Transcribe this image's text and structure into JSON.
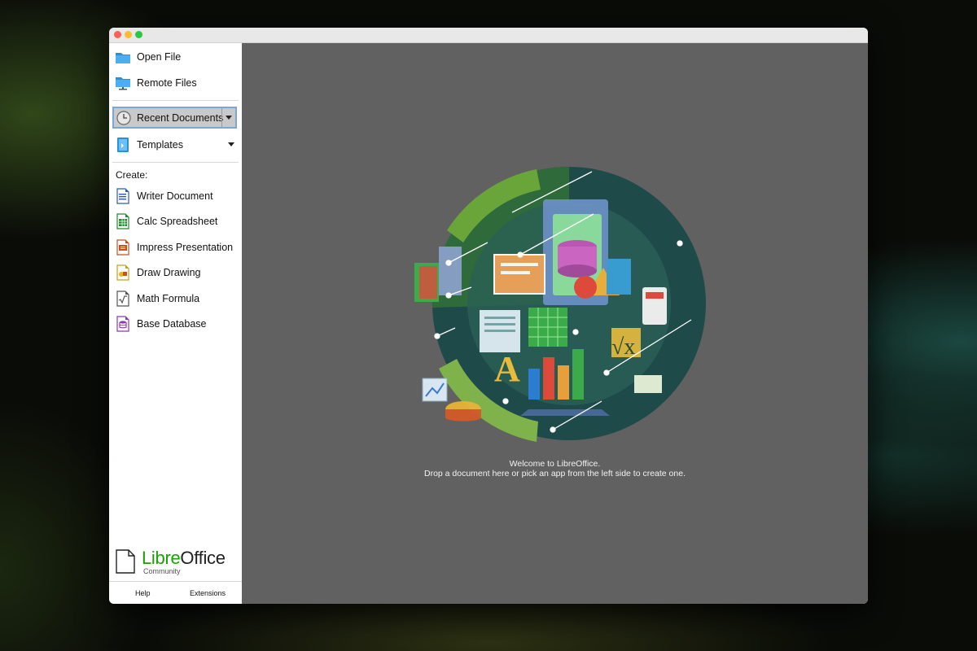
{
  "window": {
    "title": ""
  },
  "sidebar": {
    "open_file": "Open File",
    "remote_files": "Remote Files",
    "recent_documents": "Recent Documents",
    "templates": "Templates",
    "create_label": "Create:",
    "create_items": [
      {
        "label": "Writer Document",
        "icon": "writer-icon",
        "color": "#2a5bb5"
      },
      {
        "label": "Calc Spreadsheet",
        "icon": "calc-icon",
        "color": "#1f8a28"
      },
      {
        "label": "Impress Presentation",
        "icon": "impress-icon",
        "color": "#c8501a"
      },
      {
        "label": "Draw Drawing",
        "icon": "draw-icon",
        "color": "#c8a01a"
      },
      {
        "label": "Math Formula",
        "icon": "math-icon",
        "color": "#555555"
      },
      {
        "label": "Base Database",
        "icon": "base-icon",
        "color": "#8e3aa8"
      }
    ],
    "logo": {
      "libre": "Libre",
      "office": "Office",
      "edition": "Community"
    },
    "footer": {
      "help": "Help",
      "extensions": "Extensions"
    }
  },
  "main": {
    "welcome_line1": "Welcome to LibreOffice.",
    "welcome_line2": "Drop a document here or pick an app from the left side to create one."
  },
  "colors": {
    "brand_green": "#18a303",
    "main_bg": "#616161",
    "focus_border": "#7ba7d8"
  }
}
